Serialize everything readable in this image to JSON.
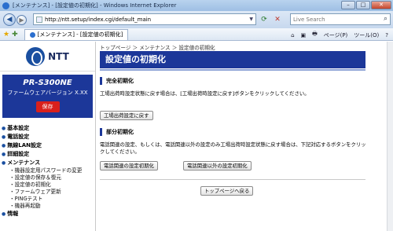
{
  "window": {
    "title": "[メンテナンス] - [設定値の初期化] - Windows Internet Explorer",
    "min_label": "–",
    "max_label": "□",
    "close_label": "✕"
  },
  "address": {
    "back_glyph": "◀",
    "forward_glyph": "▶",
    "url": "http://ntt.setup/index.cgi/default_main",
    "refresh_glyph": "⟳",
    "stop_glyph": "✕",
    "search_placeholder": "Live Search",
    "search_glyph": "⌕"
  },
  "toolbar": {
    "tab_title": "[メンテナンス] - [設定値の初期化]",
    "home_label": "⌂",
    "feeds_label": "▣",
    "print_label": "🖶",
    "page_label": "ページ(P)",
    "tools_label": "ツール(O)",
    "help_label": "?"
  },
  "sidebar": {
    "brand": "NTT",
    "product_name": "PR-S300NE",
    "fw_version": "ファームウェアバージョン X.XX",
    "save_label": "保存",
    "menu": [
      {
        "label": "基本設定"
      },
      {
        "label": "電話設定"
      },
      {
        "label": "無線LAN設定"
      },
      {
        "label": "詳細設定"
      },
      {
        "label": "メンテナンス"
      }
    ],
    "submenu": [
      "・機器設定用パスワードの変更",
      "・設定値の保存＆復元",
      "・設定値の初期化",
      "・ファームウェア更新",
      "・PINGテスト",
      "・機器再起動"
    ],
    "info_label": "情報"
  },
  "main": {
    "breadcrumb": "トップページ ＞ メンテナンス ＞ 設定値の初期化",
    "page_title": "設定値の初期化",
    "full_reset": {
      "heading": "完全初期化",
      "text": "工場出荷時設定状態に戻す場合は、[工場出荷時設定に戻す]ボタンをクリックしてください。",
      "button": "工場出荷設定に戻す"
    },
    "partial_reset": {
      "heading": "部分初期化",
      "text": "電話関連の設定、もしくは、電話関連以外の設定のみ工場出荷時設定状態に戻す場合は、下記対応するボタンをクリックしてください。",
      "button_phone": "電話関連の設定初期化",
      "button_other": "電話関連以外の設定初期化"
    },
    "back_button": "トップページへ戻る"
  }
}
